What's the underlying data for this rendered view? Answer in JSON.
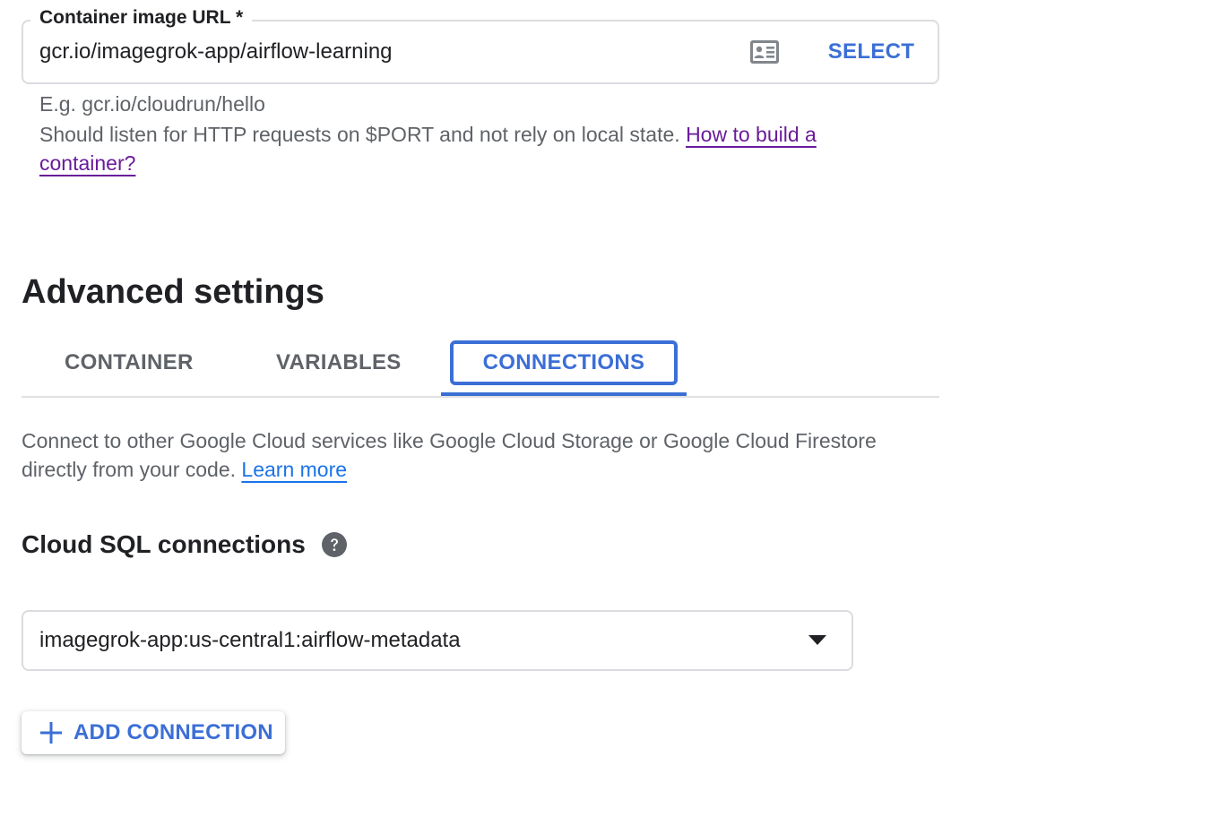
{
  "container_image": {
    "label": "Container image URL *",
    "value": "gcr.io/imagegrok-app/airflow-learning",
    "select_label": "SELECT",
    "icon": "id-card-icon",
    "example": "E.g. gcr.io/cloudrun/hello",
    "help_text": "Should listen for HTTP requests on $PORT and not rely on local state.",
    "help_link": "How to build a container?"
  },
  "advanced_settings": {
    "title": "Advanced settings",
    "tabs": [
      {
        "label": "CONTAINER",
        "selected": false
      },
      {
        "label": "VARIABLES",
        "selected": false
      },
      {
        "label": "CONNECTIONS",
        "selected": true
      }
    ]
  },
  "connections": {
    "description": "Connect to other Google Cloud services like Google Cloud Storage or Google Cloud Firestore directly from your code.",
    "learn_more": "Learn more",
    "cloud_sql": {
      "title": "Cloud SQL connections",
      "help_icon": "help-circle-icon",
      "selected_value": "imagegrok-app:us-central1:airflow-metadata",
      "dropdown_icon": "dropdown-arrow-icon"
    },
    "add_connection_label": "ADD CONNECTION",
    "add_icon": "plus-icon"
  },
  "colors": {
    "accent": "#3b6fd6",
    "visited_link": "#6a1b9a",
    "link": "#1a73e8",
    "border": "#dadce0",
    "text_secondary": "#5f6368"
  }
}
